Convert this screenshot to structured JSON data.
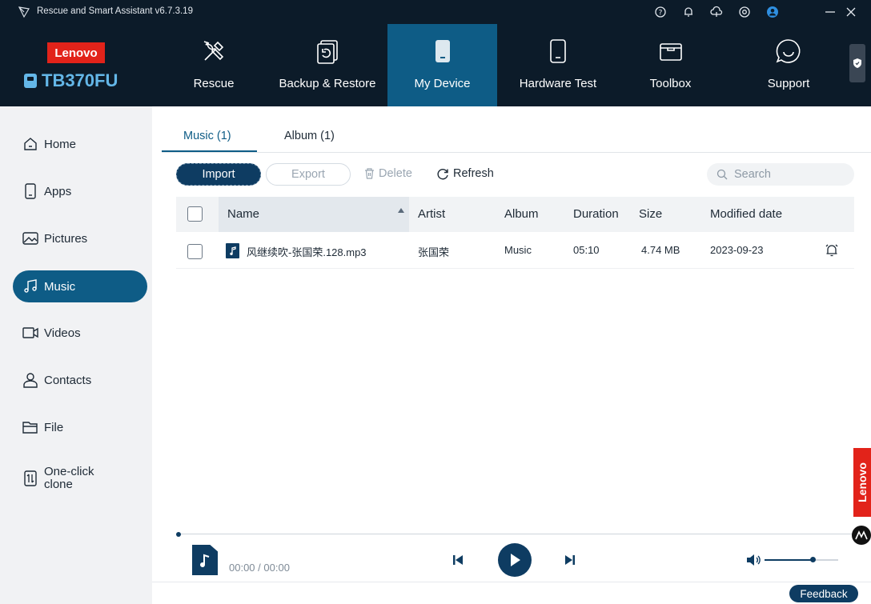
{
  "window": {
    "title": "Rescue and Smart Assistant v6.7.3.19"
  },
  "titlebar_icons": [
    "help-icon",
    "bell-icon",
    "cloud-icon",
    "settings-icon",
    "user-icon",
    "minimize-icon",
    "close-icon"
  ],
  "brand": {
    "logo_text": "Lenovo",
    "device": "TB370FU"
  },
  "nav": [
    {
      "label": "Rescue",
      "icon": "tools-icon"
    },
    {
      "label": "Backup & Restore",
      "icon": "backup-icon"
    },
    {
      "label": "My Device",
      "icon": "device-icon",
      "active": true
    },
    {
      "label": "Hardware Test",
      "icon": "phone-test-icon"
    },
    {
      "label": "Toolbox",
      "icon": "toolbox-icon"
    },
    {
      "label": "Support",
      "icon": "chat-icon"
    }
  ],
  "sidebar": [
    {
      "label": "Home",
      "icon": "home-icon"
    },
    {
      "label": "Apps",
      "icon": "apps-icon"
    },
    {
      "label": "Pictures",
      "icon": "picture-icon"
    },
    {
      "label": "Music",
      "icon": "music-icon",
      "active": true
    },
    {
      "label": "Videos",
      "icon": "video-icon"
    },
    {
      "label": "Contacts",
      "icon": "contact-icon"
    },
    {
      "label": "File",
      "icon": "folder-icon"
    },
    {
      "label": "One-click\nclone",
      "label_line1": "One-click",
      "label_line2": "clone",
      "icon": "clone-icon"
    }
  ],
  "tabs": [
    {
      "label": "Music (1)",
      "active": true
    },
    {
      "label": "Album (1)"
    }
  ],
  "toolbar": {
    "import": "Import",
    "export": "Export",
    "delete": "Delete",
    "refresh": "Refresh",
    "search_placeholder": "Search"
  },
  "table": {
    "columns": [
      "Name",
      "Artist",
      "Album",
      "Duration",
      "Size",
      "Modified date"
    ],
    "rows": [
      {
        "name": "风继续吹-张国荣.128.mp3",
        "artist": "张国荣",
        "album": "Music",
        "duration": "05:10",
        "size": "4.74 MB",
        "modified": "2023-09-23"
      }
    ]
  },
  "player": {
    "current": "00:00",
    "separator": "/",
    "total": "00:00",
    "progress": 0,
    "volume": 0.65
  },
  "feedback": "Feedback",
  "side_brand": "Lenovo",
  "colors": {
    "header_bg": "#0c1b29",
    "accent": "#0e5c86",
    "dark_button": "#0e3c62",
    "brand_red": "#e2231a"
  }
}
